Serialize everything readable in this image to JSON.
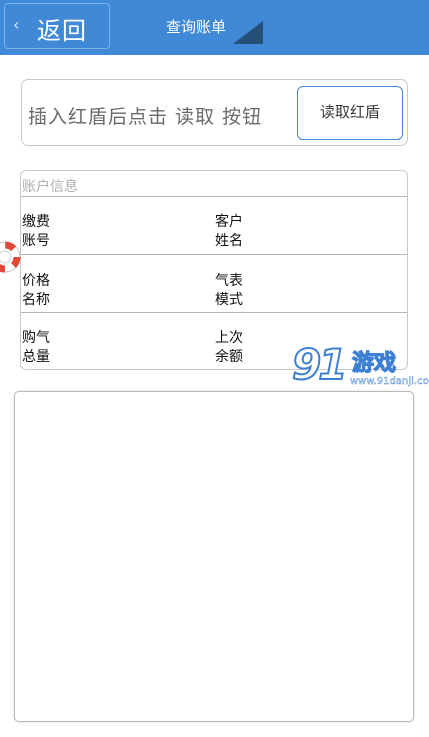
{
  "header": {
    "back_chevron": "‹",
    "back_label": "返回",
    "title": "查询账单"
  },
  "read_card": {
    "hint": "插入红盾后点击 读取 按钮",
    "button_label": "读取红盾"
  },
  "account_info": {
    "title": "账户信息",
    "fields": [
      {
        "label": "缴费\n账号",
        "value": ""
      },
      {
        "label": "客户\n姓名",
        "value": ""
      },
      {
        "label": "价格\n名称",
        "value": ""
      },
      {
        "label": "气表\n模式",
        "value": ""
      },
      {
        "label": "购气\n总量",
        "value": ""
      },
      {
        "label": "上次\n余额",
        "value": ""
      }
    ]
  },
  "watermark": {
    "mark": "91",
    "name": "游戏",
    "url": "www.91danji.com"
  },
  "colors": {
    "header_bg": "#3f89d7",
    "button_border": "#3f89d7",
    "watermark_blue": "#3d7fd0"
  },
  "icons": {
    "back": "chevron-left-icon",
    "corner": "corner-triangle-icon",
    "side": "lifebuoy-icon"
  },
  "bill_area": {
    "content": ""
  }
}
